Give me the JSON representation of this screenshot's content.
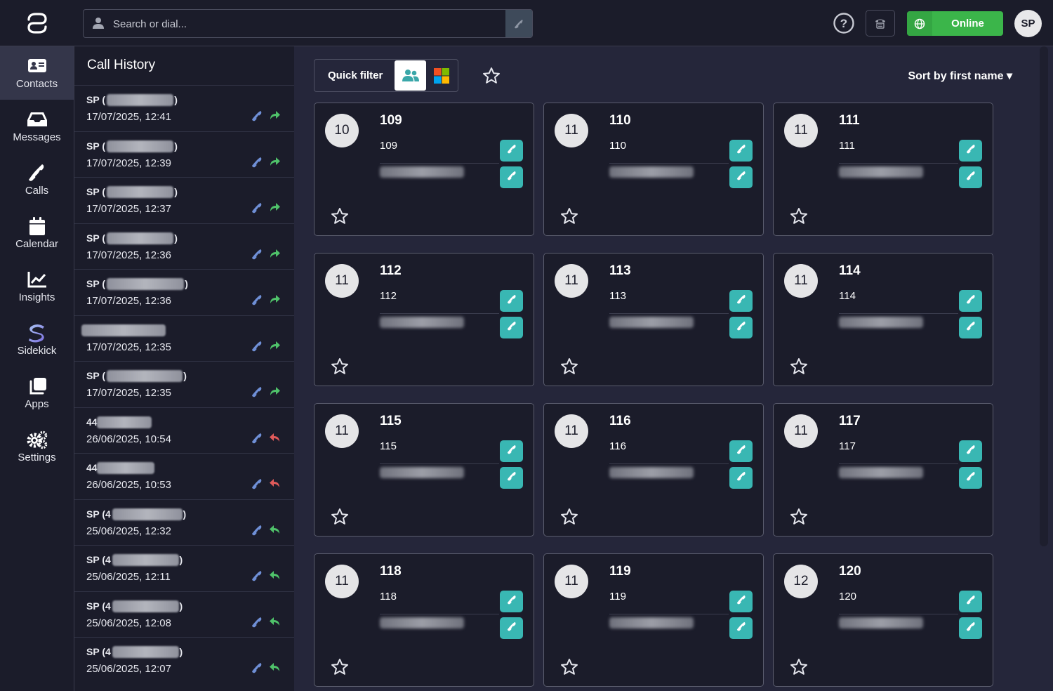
{
  "search": {
    "placeholder": "Search or dial..."
  },
  "status": {
    "label": "Online",
    "color": "#3bb54a"
  },
  "user": {
    "initials": "SP"
  },
  "nav": [
    {
      "label": "Contacts",
      "icon": "contact-card-icon",
      "active": true
    },
    {
      "label": "Messages",
      "icon": "inbox-icon"
    },
    {
      "label": "Calls",
      "icon": "phone-icon"
    },
    {
      "label": "Calendar",
      "icon": "calendar-icon"
    },
    {
      "label": "Insights",
      "icon": "chart-icon"
    },
    {
      "label": "Sidekick",
      "icon": "sidekick-icon"
    },
    {
      "label": "Apps",
      "icon": "apps-icon"
    },
    {
      "label": "Settings",
      "icon": "gear-icon"
    }
  ],
  "history": {
    "title": "Call History",
    "rows": [
      {
        "prefix": "SP (",
        "suffix": ")",
        "date": "17/07/2025, 12:41",
        "direction": "outgoing"
      },
      {
        "prefix": "SP (",
        "suffix": ")",
        "date": "17/07/2025, 12:39",
        "direction": "outgoing"
      },
      {
        "prefix": "SP (",
        "suffix": ")",
        "date": "17/07/2025, 12:37",
        "direction": "outgoing"
      },
      {
        "prefix": "SP (",
        "suffix": ")",
        "date": "17/07/2025, 12:36",
        "direction": "outgoing"
      },
      {
        "prefix": "SP (",
        "suffix": ")",
        "date": "17/07/2025, 12:36",
        "direction": "outgoing"
      },
      {
        "prefix": "",
        "suffix": "",
        "date": "17/07/2025, 12:35",
        "direction": "outgoing"
      },
      {
        "prefix": "SP (",
        "suffix": ")",
        "date": "17/07/2025, 12:35",
        "direction": "outgoing"
      },
      {
        "prefix": "44",
        "suffix": "",
        "date": "26/06/2025, 10:54",
        "direction": "missed"
      },
      {
        "prefix": "44",
        "suffix": "",
        "date": "26/06/2025, 10:53",
        "direction": "missed"
      },
      {
        "prefix": "SP (4",
        "suffix": ")",
        "date": "25/06/2025, 12:32",
        "direction": "incoming"
      },
      {
        "prefix": "SP (4",
        "suffix": ")",
        "date": "25/06/2025, 12:11",
        "direction": "incoming"
      },
      {
        "prefix": "SP (4",
        "suffix": ")",
        "date": "25/06/2025, 12:08",
        "direction": "incoming"
      },
      {
        "prefix": "SP (4",
        "suffix": ")",
        "date": "25/06/2025, 12:07",
        "direction": "incoming"
      }
    ]
  },
  "filter": {
    "label": "Quick filter"
  },
  "sort": {
    "label": "Sort by first name ▾"
  },
  "contacts": [
    {
      "initials": "10",
      "name": "109",
      "ext": "109"
    },
    {
      "initials": "11",
      "name": "110",
      "ext": "110"
    },
    {
      "initials": "11",
      "name": "111",
      "ext": "111"
    },
    {
      "initials": "11",
      "name": "112",
      "ext": "112"
    },
    {
      "initials": "11",
      "name": "113",
      "ext": "113"
    },
    {
      "initials": "11",
      "name": "114",
      "ext": "114"
    },
    {
      "initials": "11",
      "name": "115",
      "ext": "115"
    },
    {
      "initials": "11",
      "name": "116",
      "ext": "116"
    },
    {
      "initials": "11",
      "name": "117",
      "ext": "117"
    },
    {
      "initials": "11",
      "name": "118",
      "ext": "118"
    },
    {
      "initials": "11",
      "name": "119",
      "ext": "119"
    },
    {
      "initials": "12",
      "name": "120",
      "ext": "120"
    }
  ],
  "colors": {
    "accent": "#39b7b3",
    "bg": "#202131",
    "panel": "#1b1c2a",
    "missed": "#e05a5a",
    "forward": "#4fc26a"
  }
}
